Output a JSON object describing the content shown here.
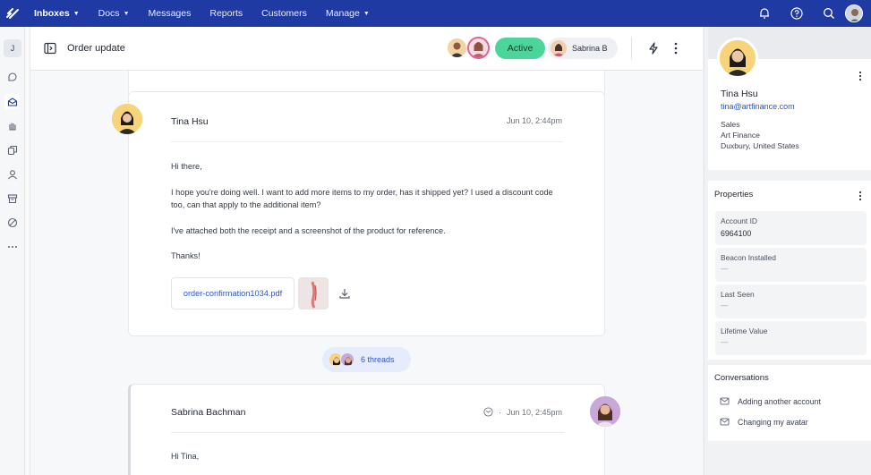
{
  "topnav": {
    "logo_icon": "helpscout-logo-icon",
    "items": [
      {
        "label": "Inboxes",
        "caret": true,
        "active": true
      },
      {
        "label": "Docs",
        "caret": true
      },
      {
        "label": "Messages"
      },
      {
        "label": "Reports"
      },
      {
        "label": "Customers"
      },
      {
        "label": "Manage",
        "caret": true
      }
    ],
    "right_icons": [
      "bell-icon",
      "help-icon",
      "search-icon"
    ],
    "bg_color": "#1f3aa3"
  },
  "leftrail": {
    "workspace_initial": "J",
    "icons": [
      "chat-icon",
      "inbox-icon",
      "hand-icon",
      "copy-icon",
      "user-icon",
      "archive-icon",
      "blocked-icon",
      "more-icon"
    ],
    "selected_index": 1
  },
  "conversation": {
    "title": "Order update",
    "status": "Active",
    "status_color": "#4cd59a",
    "assignee": "Sabrina B"
  },
  "message1": {
    "sender": "Tina Hsu",
    "time": "Jun 10, 2:44pm",
    "paragraphs": [
      "Hi there,",
      "I hope you're doing well. I want to add more items to my order, has it shipped yet? I used a discount code too, can that apply to the additional item?",
      "I've attached both the receipt and a screenshot of the product for reference.",
      "Thanks!"
    ],
    "attachment": "order-confirmation1034.pdf"
  },
  "threads": {
    "label": "6 threads"
  },
  "message2": {
    "sender": "Sabrina Bachman",
    "time": "Jun 10, 2:45pm",
    "body": "Hi Tina,"
  },
  "customer": {
    "name": "Tina Hsu",
    "email": "tina@artfinance.com",
    "role": "Sales",
    "company": "Art Finance",
    "location": "Duxbury, United States"
  },
  "properties": {
    "title": "Properties",
    "items": [
      {
        "label": "Account ID",
        "value": "6964100"
      },
      {
        "label": "Beacon Installed",
        "value": "—"
      },
      {
        "label": "Last Seen",
        "value": "—"
      },
      {
        "label": "Lifetime Value",
        "value": "—"
      }
    ]
  },
  "conversations_panel": {
    "title": "Conversations",
    "items": [
      "Adding another account",
      "Changing my avatar"
    ]
  }
}
